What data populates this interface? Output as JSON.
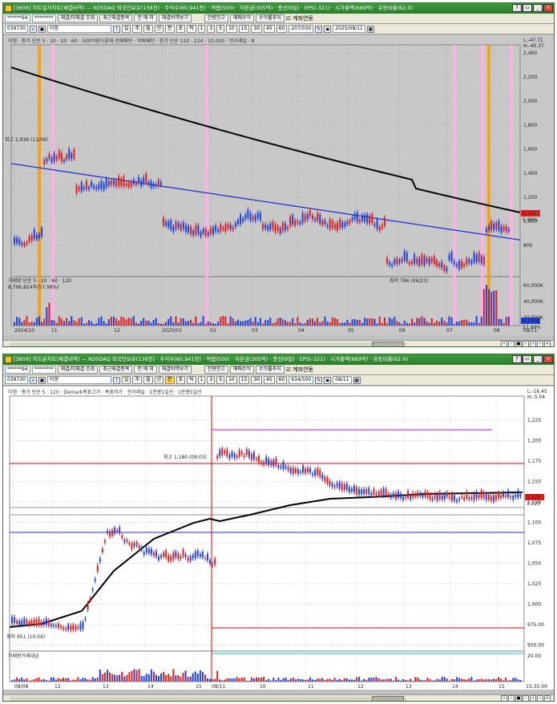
{
  "window1": {
    "title": "[3606] 차트일자차트(체결비역) — KOSDAQ 외국인보유(136천) · 주식수(60,941천) · 적법(500) · 자본금(305억) · 증선(9일) · EPS(-321) · 시가총액(669억) · 유동비율(62.0)",
    "toolbar": {
      "account": "******94",
      "password": "********",
      "btn_query": "체결/미체결 조회",
      "btn_recent": "최근체결종목",
      "btn_tabs": "전 매 미",
      "btn_history": "체결비역보기",
      "btn_balance": "잔량잔고",
      "btn_trade_profit": "매매수익",
      "btn_profit_track": "수익률추이",
      "chk_account_link": "계좌연동",
      "code": "039730",
      "search_term": "이엠",
      "periods": [
        "일",
        "주",
        "월",
        "년",
        "분",
        "초",
        "틱"
      ],
      "minutes": [
        "1",
        "3",
        "5",
        "10",
        "15",
        "30",
        "45",
        "60"
      ],
      "count": "207/500",
      "date": "2025/08/11"
    },
    "legend": {
      "main": "이엠 · 종가 단순 5 · 10 · 20 · 60 · 500억원이론에 진배패턴 · 억배패턴 · 종가 단순 120 · 224 · 10,000 · 전거래일 · 8",
      "volume": "거래량 단순 5 · 20 · 60 · 120",
      "volume_value": "8,796,824주(57.99%)"
    },
    "annotations": {
      "high": "최고 1,936 (11/06)",
      "low": "최저 786 (06/23)"
    },
    "price_axis": [
      "2,400",
      "2,200",
      "2,000",
      "1,800",
      "1,600",
      "1,400",
      "1,200",
      "1,000",
      "800"
    ],
    "volume_axis": [
      "60,000K",
      "40,000K",
      "20,000K"
    ],
    "date_axis": [
      "2024/10",
      "11",
      "12",
      "2025/01",
      "02",
      "03",
      "04",
      "05",
      "06",
      "07",
      "08"
    ],
    "right_top": [
      "L:-47.71",
      "H:-40.37"
    ],
    "price_badge": "1,120",
    "price_badge2": "5.90%",
    "vol_badge": "8,797K",
    "vol_badge2": "57.99%",
    "last_date": "08/11"
  },
  "window2": {
    "title": "[3606] 차트분차트(체결비역) — KOSDAQ 외국인보유(136천) · 주식수(60,941천) · 적법(500) · 자본금(305억) · 증선(9일) · EPS(-321) · 시가총액(669억) · 유동비율(62.0)",
    "toolbar": {
      "account": "******94",
      "password": "********",
      "btn_query": "체결/미체결 조회",
      "btn_recent": "최근체결종목",
      "btn_tabs": "전 매 미",
      "btn_history": "체결비역보기",
      "btn_balance": "잔량잔고",
      "btn_trade_profit": "매매수익",
      "btn_profit_track": "수익률추이",
      "chk_account_link": "계좌연동",
      "code": "039730",
      "search_term": "이엠",
      "periods": [
        "일",
        "주",
        "월",
        "년",
        "분",
        "초",
        "틱"
      ],
      "minutes": [
        "1",
        "3",
        "5",
        "10",
        "15",
        "30",
        "45",
        "60"
      ],
      "count": "634/500",
      "date": "08/11"
    },
    "legend": {
      "main": "이엠 · 종가 단순 5 · 120 · Demark목표고가 · 목표저가 · 전거래일 · 1분봉1일선 · 1분봉5일선",
      "volume": "거래량거래대금"
    },
    "annotations": {
      "high": "최고 1,180 (09:03)",
      "low": "최저 951 (10:56)"
    },
    "price_axis": [
      "1,225",
      "1,200",
      "1,175",
      "1,150",
      "1,125",
      "1,100",
      "1,075",
      "1,050",
      "1,025",
      "1,000",
      "975.00",
      "950.00"
    ],
    "volume_axis": [
      "20.00"
    ],
    "date_axis": [
      "08/08",
      "12",
      "13",
      "14",
      "15",
      "08/11",
      "10",
      "11",
      "12",
      "13",
      "14",
      "15"
    ],
    "right_top": [
      "L:-16.45",
      "H:-5.04"
    ],
    "price_badge": "1,120",
    "price_badge2": "1,120",
    "time": "15:35:00"
  },
  "colors": {
    "title_green": "#2c7d2c",
    "candle_up": "#e02020",
    "candle_down": "#2040e0",
    "ma_long": "#000000",
    "ma_blue": "#1f2fd0",
    "highlight_orange": "#ff9a00",
    "highlight_pink": "#ffb0e8"
  }
}
